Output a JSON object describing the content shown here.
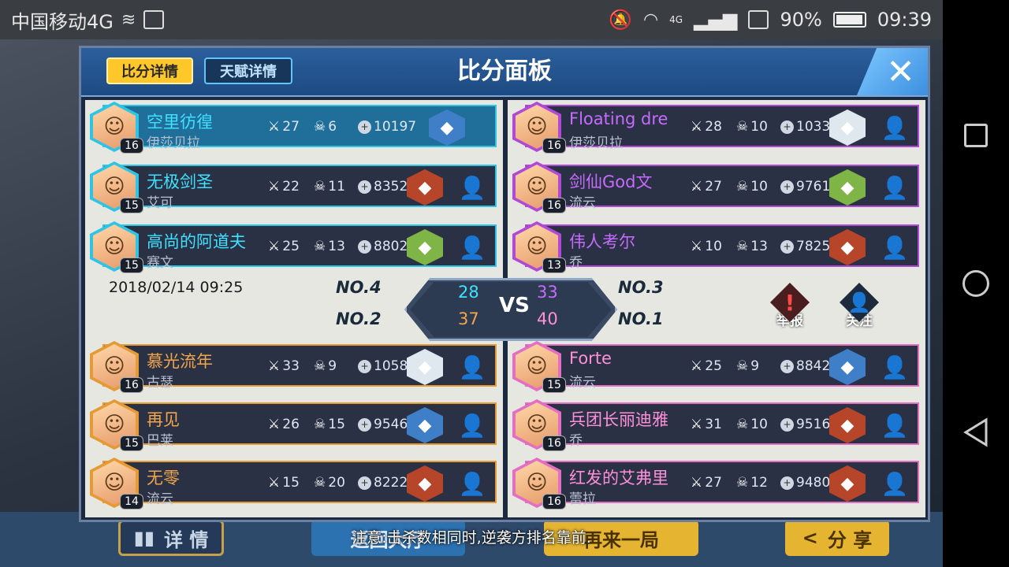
{
  "status_bar": {
    "carrier": "中国移动4G",
    "network": "4G",
    "battery": "90%",
    "time": "09:39"
  },
  "panel": {
    "tabs": {
      "score": "比分详情",
      "talent": "天赋详情"
    },
    "title": "比分面板",
    "date": "2018/02/14 09:25"
  },
  "match": {
    "blue_kills": "28",
    "blue_score": "37",
    "purple_kills": "33",
    "purple_score": "40",
    "vs": "VS",
    "rank_top_left": "NO.4",
    "rank_bottom_left": "NO.2",
    "rank_top_right": "NO.3",
    "rank_bottom_right": "NO.1"
  },
  "actions": {
    "report": "举报",
    "follow": "关注"
  },
  "teams": {
    "top_left": [
      {
        "name": "空里彷徨",
        "char": "伊莎贝拉",
        "level": "16",
        "kills": "27",
        "deaths": "6",
        "gold": "10197"
      },
      {
        "name": "无极剑圣",
        "char": "艾可",
        "level": "15",
        "kills": "22",
        "deaths": "11",
        "gold": "8352"
      },
      {
        "name": "高尚的阿道夫",
        "char": "赛文",
        "level": "15",
        "kills": "25",
        "deaths": "13",
        "gold": "8802"
      }
    ],
    "top_right": [
      {
        "name": "Floating dre",
        "char": "伊莎贝拉",
        "level": "16",
        "kills": "28",
        "deaths": "10",
        "gold": "10331"
      },
      {
        "name": "剑仙God文",
        "char": "流云",
        "level": "16",
        "kills": "27",
        "deaths": "10",
        "gold": "9761"
      },
      {
        "name": "伟人考尔",
        "char": "乔",
        "level": "13",
        "kills": "10",
        "deaths": "13",
        "gold": "7825"
      }
    ],
    "bottom_left": [
      {
        "name": "慕光流年",
        "char": "古瑟",
        "level": "16",
        "kills": "33",
        "deaths": "9",
        "gold": "10583"
      },
      {
        "name": "再见",
        "char": "巴莱",
        "level": "15",
        "kills": "26",
        "deaths": "15",
        "gold": "9546"
      },
      {
        "name": "无零",
        "char": "流云",
        "level": "14",
        "kills": "15",
        "deaths": "20",
        "gold": "8222"
      }
    ],
    "bottom_right": [
      {
        "name": "Forte",
        "char": "流云",
        "level": "15",
        "kills": "25",
        "deaths": "9",
        "gold": "8842"
      },
      {
        "name": "兵团长丽迪雅",
        "char": "乔",
        "level": "16",
        "kills": "31",
        "deaths": "10",
        "gold": "9516"
      },
      {
        "name": "红发的艾弗里",
        "char": "蕾拉",
        "level": "16",
        "kills": "27",
        "deaths": "12",
        "gold": "9480"
      }
    ]
  },
  "bottom": {
    "detail": "详 情",
    "hall": "返回大厅",
    "again": "再来一局",
    "share": "分 享",
    "notice": "注意:击杀数相同时,逆袭方排名靠前."
  }
}
